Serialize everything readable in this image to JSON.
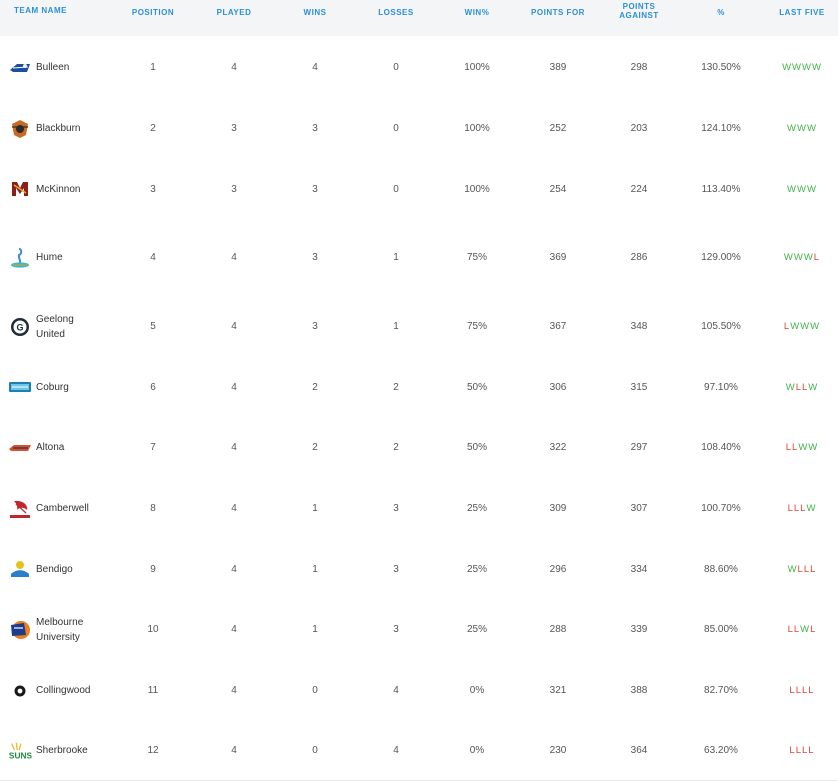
{
  "columns": {
    "team": "TEAM NAME",
    "position": "POSITION",
    "played": "PLAYED",
    "wins": "WINS",
    "losses": "LOSSES",
    "winpct": "WIN%",
    "points_for": "POINTS FOR",
    "points_against": "POINTS AGAINST",
    "pct": "%",
    "last_five": "LAST FIVE"
  },
  "colors": {
    "header_text": "#2b8fd6",
    "win": "#44b34a",
    "loss": "#e0443c"
  },
  "rows": [
    {
      "team": "Bulleen",
      "logo": "bulleen-logo",
      "position": "1",
      "played": "4",
      "wins": "4",
      "losses": "0",
      "winpct": "100%",
      "pf": "389",
      "pa": "298",
      "pct": "130.50%",
      "last": [
        "W",
        "W",
        "W",
        "W"
      ]
    },
    {
      "team": "Blackburn",
      "logo": "blackburn-logo",
      "position": "2",
      "played": "3",
      "wins": "3",
      "losses": "0",
      "winpct": "100%",
      "pf": "252",
      "pa": "203",
      "pct": "124.10%",
      "last": [
        "W",
        "W",
        "W"
      ]
    },
    {
      "team": "McKinnon",
      "logo": "mckinnon-logo",
      "position": "3",
      "played": "3",
      "wins": "3",
      "losses": "0",
      "winpct": "100%",
      "pf": "254",
      "pa": "224",
      "pct": "113.40%",
      "last": [
        "W",
        "W",
        "W"
      ]
    },
    {
      "team": "Hume",
      "logo": "hume-logo",
      "position": "4",
      "played": "4",
      "wins": "3",
      "losses": "1",
      "winpct": "75%",
      "pf": "369",
      "pa": "286",
      "pct": "129.00%",
      "last": [
        "W",
        "W",
        "W",
        "L"
      ]
    },
    {
      "team": "Geelong United",
      "team_line1": "Geelong",
      "team_line2": "United",
      "logo": "geelong-logo",
      "position": "5",
      "played": "4",
      "wins": "3",
      "losses": "1",
      "winpct": "75%",
      "pf": "367",
      "pa": "348",
      "pct": "105.50%",
      "last": [
        "L",
        "W",
        "W",
        "W"
      ]
    },
    {
      "team": "Coburg",
      "logo": "coburg-logo",
      "position": "6",
      "played": "4",
      "wins": "2",
      "losses": "2",
      "winpct": "50%",
      "pf": "306",
      "pa": "315",
      "pct": "97.10%",
      "last": [
        "W",
        "L",
        "L",
        "W"
      ]
    },
    {
      "team": "Altona",
      "logo": "altona-logo",
      "position": "7",
      "played": "4",
      "wins": "2",
      "losses": "2",
      "winpct": "50%",
      "pf": "322",
      "pa": "297",
      "pct": "108.40%",
      "last": [
        "L",
        "L",
        "W",
        "W"
      ]
    },
    {
      "team": "Camberwell",
      "logo": "camberwell-logo",
      "position": "8",
      "played": "4",
      "wins": "1",
      "losses": "3",
      "winpct": "25%",
      "pf": "309",
      "pa": "307",
      "pct": "100.70%",
      "last": [
        "L",
        "L",
        "L",
        "W"
      ]
    },
    {
      "team": "Bendigo",
      "logo": "bendigo-logo",
      "position": "9",
      "played": "4",
      "wins": "1",
      "losses": "3",
      "winpct": "25%",
      "pf": "296",
      "pa": "334",
      "pct": "88.60%",
      "last": [
        "W",
        "L",
        "L",
        "L"
      ]
    },
    {
      "team": "Melbourne University",
      "team_line1": "Melbourne",
      "team_line2": "University",
      "logo": "melbourne-uni-logo",
      "position": "10",
      "played": "4",
      "wins": "1",
      "losses": "3",
      "winpct": "25%",
      "pf": "288",
      "pa": "339",
      "pct": "85.00%",
      "last": [
        "L",
        "L",
        "W",
        "L"
      ]
    },
    {
      "team": "Collingwood",
      "logo": "collingwood-logo",
      "position": "11",
      "played": "4",
      "wins": "0",
      "losses": "4",
      "winpct": "0%",
      "pf": "321",
      "pa": "388",
      "pct": "82.70%",
      "last": [
        "L",
        "L",
        "L",
        "L"
      ]
    },
    {
      "team": "Sherbrooke",
      "logo": "sherbrooke-logo",
      "position": "12",
      "played": "4",
      "wins": "0",
      "losses": "4",
      "winpct": "0%",
      "pf": "230",
      "pa": "364",
      "pct": "63.20%",
      "last": [
        "L",
        "L",
        "L",
        "L"
      ]
    }
  ]
}
